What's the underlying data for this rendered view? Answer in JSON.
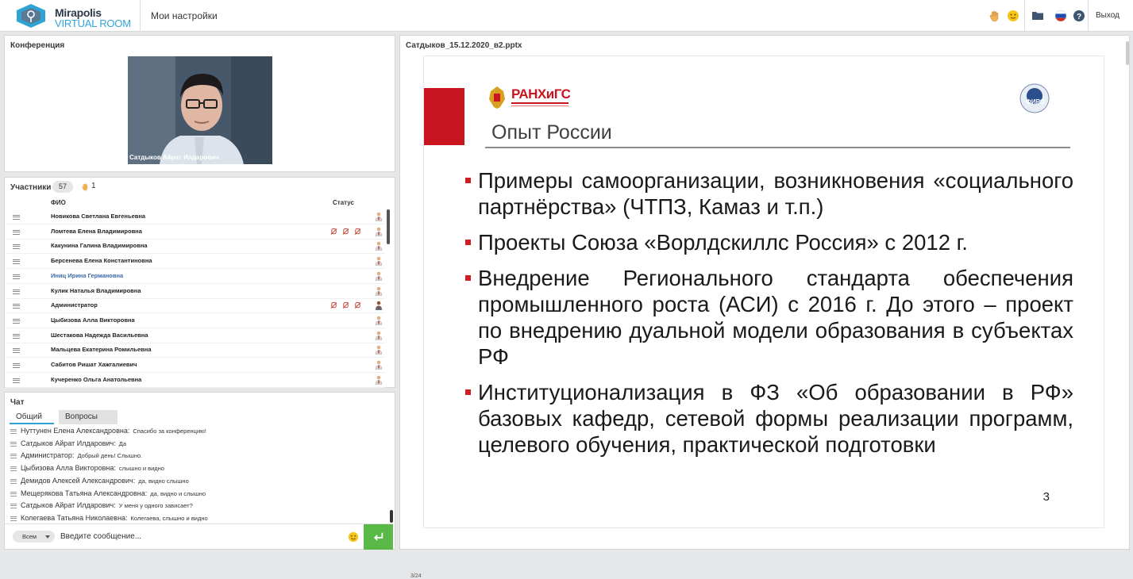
{
  "app": {
    "logo_line1": "Mirapolis",
    "logo_line2": "VIRTUAL ROOM",
    "settings_label": "Мои настройки",
    "exit_label": "Выход"
  },
  "conference": {
    "title": "Конференция",
    "video_caption": "Сатдыков Айрат  Илдарович"
  },
  "participants": {
    "title": "Участники",
    "count": "57",
    "raised_hands": "1",
    "col_name": "ФИО",
    "col_status": "Статус",
    "rows": [
      {
        "name": "Новикова Светлана  Евгеньевна"
      },
      {
        "name": "Ломтева Елена  Владимировна"
      },
      {
        "name": "Какунина Галина  Владимировна"
      },
      {
        "name": "Берсенева Елена   Константиновна"
      },
      {
        "name": "Иниц  Ирина  Германовна"
      },
      {
        "name": "Кулик  Наталья   Владимировна"
      },
      {
        "name": "Администратор"
      },
      {
        "name": "Цыбизова Алла Викторовна"
      },
      {
        "name": "Шестакова Надежда  Васильевна"
      },
      {
        "name": "Мальцева  Екатерина  Ромильевна"
      },
      {
        "name": "Сабитов Ришат  Хажгалиевич"
      },
      {
        "name": "Кучеренко Ольга  Анатольевна"
      }
    ]
  },
  "chat": {
    "title": "Чат",
    "tab_general": "Общий",
    "tab_questions": "Вопросы",
    "messages": [
      {
        "author": "Нуттунен Елена   Александровна:",
        "text": "Спасибо за конференцию!"
      },
      {
        "author": "Сатдыков Айрат  Илдарович:",
        "text": "Да"
      },
      {
        "author": "Администратор:",
        "text": "Добрый день! Слышно."
      },
      {
        "author": "Цыбизова Алла Викторовна:",
        "text": "слышно и видно"
      },
      {
        "author": "Демидов Алексей   Александрович:",
        "text": "да, видно слышно"
      },
      {
        "author": "Мещерякова Татьяна  Александровна:",
        "text": "да, видно и слышно"
      },
      {
        "author": "Сатдыков Айрат  Илдарович:",
        "text": "У меня у одного зависает?"
      },
      {
        "author": "Колегаева Татьяна  Николаевна:",
        "text": "Колегаева, слышно и видно"
      }
    ],
    "recipient": "Всем",
    "input_placeholder": "Введите сообщение..."
  },
  "presentation": {
    "filename": "Сатдыков_15.12.2020_в2.pptx",
    "slide_counter": "3/24",
    "slide": {
      "logo_text": "РАНХиГС",
      "logo_right": "ФИРО",
      "heading": "Опыт России",
      "bullets": [
        "Примеры самоорганизации, возникновения «социального партнёрства» (ЧТПЗ, Камаз и т.п.)",
        "Проекты Союза «Ворлдскиллс Россия» с 2012 г.",
        "Внедрение Регионального стандарта обеспечения промышленного роста (АСИ) с 2016 г. До этого – проект по внедрению дуальной модели образования в субъектах РФ",
        "Институционализация в ФЗ «Об образовании в РФ» базовых кафедр, сетевой формы реализации программ, целевого обучения, практической подготовки"
      ],
      "page_number": "3"
    }
  },
  "colors": {
    "accent": "#2fa4d4",
    "send_green": "#58b947",
    "slide_red": "#c8151f"
  }
}
